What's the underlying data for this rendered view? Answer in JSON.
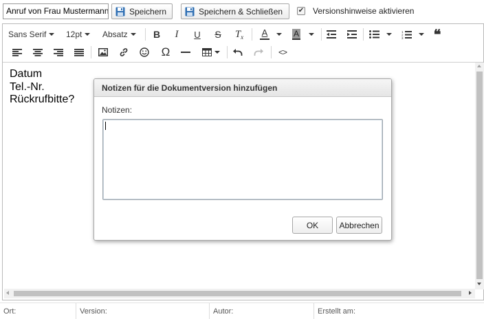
{
  "topbar": {
    "title_value": "Anruf von Frau Mustermann",
    "save_label": "Speichern",
    "save_close_label": "Speichern & Schließen",
    "version_notes_label": "Versionshinweise aktivieren",
    "version_notes_checked": true
  },
  "toolbar": {
    "font_family": "Sans Serif",
    "font_size": "12pt",
    "block_format": "Absatz",
    "bold_glyph": "B",
    "italic_glyph": "I",
    "underline_glyph": "U",
    "strike_glyph": "S",
    "clear_format_glyph": "T",
    "text_color_glyph": "A",
    "bg_color_glyph": "A",
    "quote_glyph": "❝",
    "omega_glyph": "Ω",
    "code_glyph": "<>",
    "icons": [
      "bold-icon",
      "italic-icon",
      "underline-icon",
      "strikethrough-icon",
      "clear-formatting-icon",
      "text-color-icon",
      "background-color-icon",
      "outdent-icon",
      "indent-icon",
      "bullet-list-icon",
      "numbered-list-icon",
      "blockquote-icon",
      "align-left-icon",
      "align-center-icon",
      "align-right-icon",
      "align-justify-icon",
      "image-icon",
      "link-icon",
      "emoticon-icon",
      "special-character-icon",
      "horizontal-rule-icon",
      "table-icon",
      "undo-icon",
      "redo-icon",
      "source-code-icon"
    ]
  },
  "document": {
    "lines": [
      "Datum",
      "Tel.-Nr.",
      "Rückrufbitte?"
    ]
  },
  "statusbar": {
    "location_label": "Ort:",
    "version_label": "Version:",
    "author_label": "Autor:",
    "created_label": "Erstellt am:"
  },
  "dialog": {
    "title": "Notizen für die Dokumentversion hinzufügen",
    "notes_label": "Notizen:",
    "notes_value": "",
    "ok_label": "OK",
    "cancel_label": "Abbrechen"
  },
  "colors": {
    "save_icon": "#2f6fb3",
    "dialog_header": "#e9e9e9",
    "scroll_thumb": "#c1c1c1"
  }
}
